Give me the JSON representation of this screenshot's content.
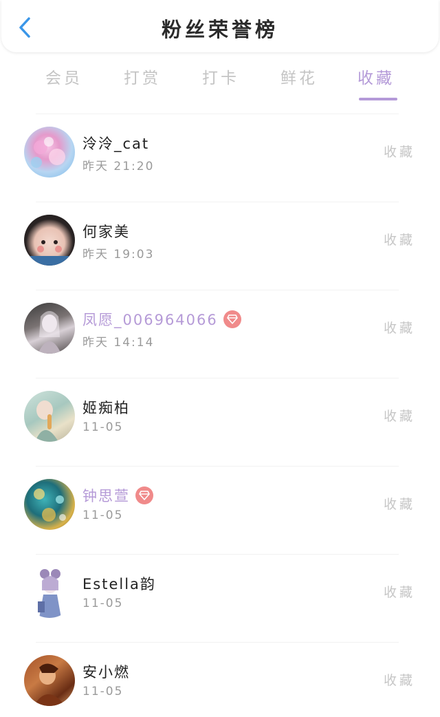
{
  "header": {
    "back_icon": "chevron-left-icon",
    "title": "粉丝荣誉榜",
    "accent_color": "#3a96e8"
  },
  "tabs": [
    {
      "label": "会员",
      "active": false
    },
    {
      "label": "打赏",
      "active": false
    },
    {
      "label": "打卡",
      "active": false
    },
    {
      "label": "鲜花",
      "active": false
    },
    {
      "label": "收藏",
      "active": true
    }
  ],
  "colors": {
    "active_tab": "#b49ad8",
    "vip_name": "#b59ad7",
    "vip_badge": "#f08a8a"
  },
  "fans": [
    {
      "name": "泠泠_cat",
      "time": "昨天 21:20",
      "vip": false,
      "action": "收藏"
    },
    {
      "name": "何家美",
      "time": "昨天 19:03",
      "vip": false,
      "action": "收藏"
    },
    {
      "name": "凤愿_006964066",
      "time": "昨天 14:14",
      "vip": true,
      "badge_icon": "diamond-icon",
      "action": "收藏"
    },
    {
      "name": "姬痴柏",
      "time": "11-05",
      "vip": false,
      "action": "收藏"
    },
    {
      "name": "钟思萱",
      "time": "11-05",
      "vip": true,
      "badge_icon": "diamond-icon",
      "action": "收藏"
    },
    {
      "name": "Estella韵",
      "time": "11-05",
      "vip": false,
      "action": "收藏"
    },
    {
      "name": "安小燃",
      "time": "11-05",
      "vip": false,
      "action": "收藏"
    }
  ]
}
